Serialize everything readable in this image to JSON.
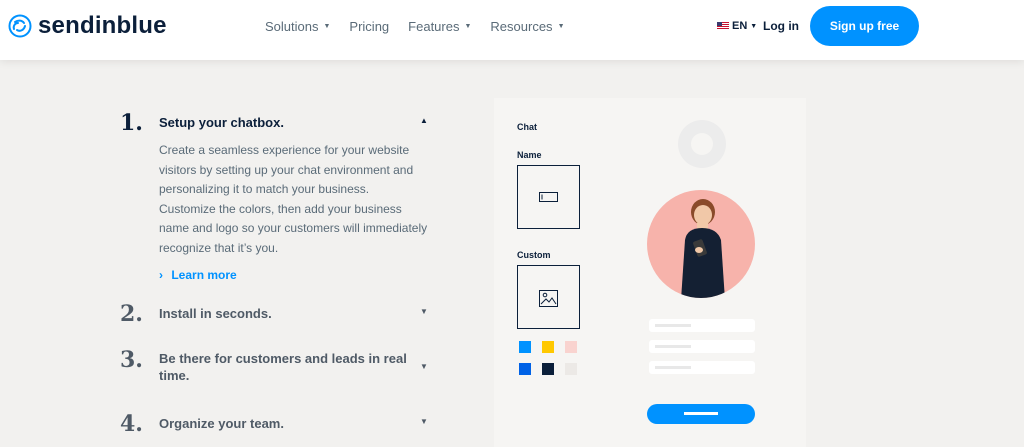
{
  "brand": {
    "name": "sendinblue",
    "accent": "#0092ff",
    "dark": "#0b1f3a"
  },
  "nav": {
    "items": [
      {
        "label": "Solutions",
        "has_caret": true
      },
      {
        "label": "Pricing",
        "has_caret": false
      },
      {
        "label": "Features",
        "has_caret": true
      },
      {
        "label": "Resources",
        "has_caret": true
      }
    ]
  },
  "header": {
    "language": "EN",
    "login": "Log in",
    "signup": "Sign up free"
  },
  "steps": [
    {
      "num": "1.",
      "title": "Setup your chatbox.",
      "expanded": true,
      "description": "Create a seamless experience for your website visitors by setting up your chat environment and personalizing it to match your business. Customize the colors, then add your business name and logo so your customers will immediately recognize that it’s you.",
      "link": "Learn more"
    },
    {
      "num": "2.",
      "title": "Install in seconds.",
      "expanded": false
    },
    {
      "num": "3.",
      "title": "Be there for customers and leads in real time.",
      "expanded": false
    },
    {
      "num": "4.",
      "title": "Organize your team.",
      "expanded": false
    }
  ],
  "preview": {
    "chat_label": "Chat",
    "name_label": "Name",
    "custom_label": "Custom",
    "swatches": [
      "#0092ff",
      "#ffc800",
      "#f9d3cf",
      "#0062e6",
      "#0b1f3a",
      "#ece9e6"
    ]
  }
}
